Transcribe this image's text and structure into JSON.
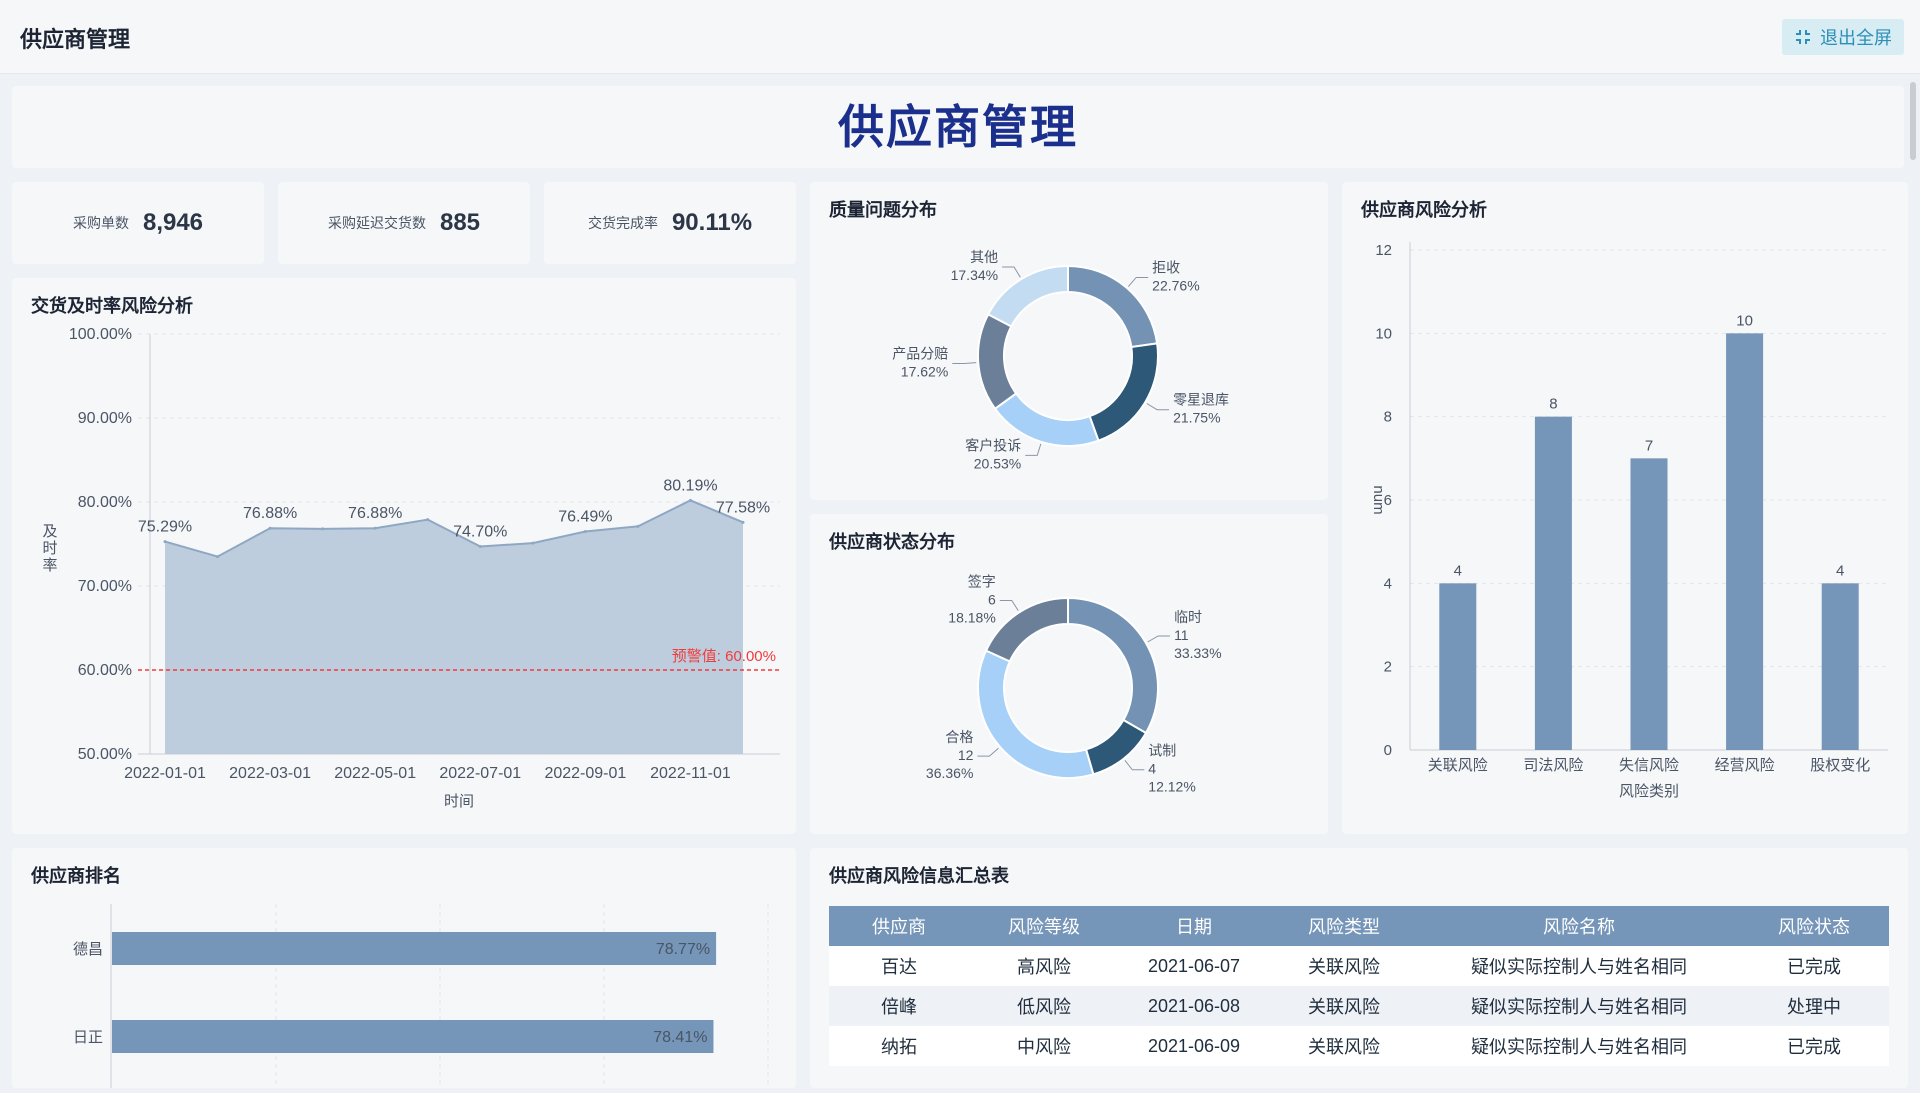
{
  "app": {
    "title": "供应商管理",
    "exit_label": "退出全屏"
  },
  "banner": {
    "title": "供应商管理"
  },
  "kpis": [
    {
      "label": "采购单数",
      "value": "8,946"
    },
    {
      "label": "采购延迟交货数",
      "value": "885"
    },
    {
      "label": "交货完成率",
      "value": "90.11%"
    }
  ],
  "panels": {
    "delivery": "交货及时率风险分析",
    "quality": "质量问题分布",
    "status": "供应商状态分布",
    "risk": "供应商风险分析",
    "ranking": "供应商排名",
    "table": "供应商风险信息汇总表"
  },
  "chart_data": [
    {
      "type": "area",
      "title": "交货及时率风险分析",
      "xlabel": "时间",
      "ylabel": "及时率",
      "x_ticks": [
        "2022-01-01",
        "2022-03-01",
        "2022-05-01",
        "2022-07-01",
        "2022-09-01",
        "2022-11-01"
      ],
      "y_ticks": [
        "50.00%",
        "60.00%",
        "70.00%",
        "80.00%",
        "90.00%",
        "100.00%"
      ],
      "x_dates": [
        "2022-01-01",
        "2022-02-01",
        "2022-03-01",
        "2022-04-01",
        "2022-05-01",
        "2022-06-01",
        "2022-07-01",
        "2022-08-01",
        "2022-09-01",
        "2022-10-01",
        "2022-11-01",
        "2022-12-01"
      ],
      "values": [
        75.29,
        73.5,
        76.88,
        76.8,
        76.88,
        77.9,
        74.7,
        75.1,
        76.49,
        77.1,
        80.19,
        77.58
      ],
      "labels": [
        {
          "index": 0,
          "text": "75.29%"
        },
        {
          "index": 2,
          "text": "76.88%"
        },
        {
          "index": 4,
          "text": "76.88%"
        },
        {
          "index": 6,
          "text": "74.70%"
        },
        {
          "index": 8,
          "text": "76.49%"
        },
        {
          "index": 10,
          "text": "80.19%"
        },
        {
          "index": 11,
          "text": "77.58%"
        }
      ],
      "warning": {
        "value": 60,
        "label": "预警值: 60.00%",
        "color": "#f03b3b"
      },
      "color": "#b8c8da"
    },
    {
      "type": "pie",
      "title": "质量问题分布",
      "slices": [
        {
          "name": "拒收",
          "pct": "22.76%",
          "value": 22.76,
          "color": "#7492b4"
        },
        {
          "name": "零星退库",
          "pct": "21.75%",
          "value": 21.75,
          "color": "#2d5878"
        },
        {
          "name": "客户投诉",
          "pct": "20.53%",
          "value": 20.53,
          "color": "#a6d0f8"
        },
        {
          "name": "产品分赔",
          "pct": "17.62%",
          "value": 17.62,
          "color": "#6b7f98"
        },
        {
          "name": "其他",
          "pct": "17.34%",
          "value": 17.34,
          "color": "#c3dcf1"
        }
      ]
    },
    {
      "type": "pie",
      "title": "供应商状态分布",
      "slices": [
        {
          "name": "临时",
          "count": "11",
          "pct": "33.33%",
          "value": 33.33,
          "color": "#7492b4"
        },
        {
          "name": "试制",
          "count": "4",
          "pct": "12.12%",
          "value": 12.12,
          "color": "#2d5878"
        },
        {
          "name": "合格",
          "count": "12",
          "pct": "36.36%",
          "value": 36.36,
          "color": "#a6d0f8"
        },
        {
          "name": "签字",
          "count": "6",
          "pct": "18.18%",
          "value": 18.18,
          "color": "#6b7f98"
        }
      ]
    },
    {
      "type": "bar",
      "title": "供应商风险分析",
      "xlabel": "风险类别",
      "ylabel": "num",
      "categories": [
        "关联风险",
        "司法风险",
        "失信风险",
        "经营风险",
        "股权变化"
      ],
      "values": [
        4,
        8,
        7,
        10,
        4
      ],
      "ylim": [
        0,
        12
      ],
      "y_ticks": [
        "0",
        "2",
        "4",
        "6",
        "8",
        "10",
        "12"
      ],
      "color": "#7595b9"
    },
    {
      "type": "bar",
      "title": "供应商排名",
      "orientation": "horizontal",
      "categories": [
        "德昌",
        "日正"
      ],
      "values": [
        78.77,
        78.41
      ],
      "labels": [
        "78.77%",
        "78.41%"
      ],
      "color": "#7595b9"
    },
    {
      "type": "table",
      "title": "供应商风险信息汇总表",
      "columns": [
        "供应商",
        "风险等级",
        "日期",
        "风险类型",
        "风险名称",
        "风险状态"
      ],
      "rows": [
        [
          "百达",
          "高风险",
          "2021-06-07",
          "关联风险",
          "疑似实际控制人与姓名相同",
          "已完成"
        ],
        [
          "倍峰",
          "低风险",
          "2021-06-08",
          "关联风险",
          "疑似实际控制人与姓名相同",
          "处理中"
        ],
        [
          "纳拓",
          "中风险",
          "2021-06-09",
          "关联风险",
          "疑似实际控制人与姓名相同",
          "已完成"
        ]
      ]
    }
  ]
}
